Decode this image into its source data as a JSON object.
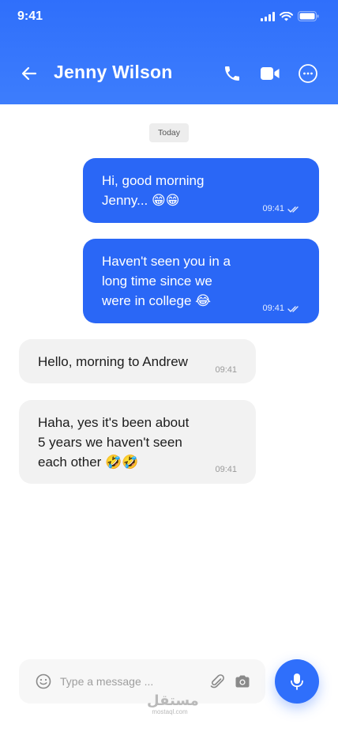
{
  "status_bar": {
    "time": "9:41"
  },
  "header": {
    "contact_name": "Jenny Wilson"
  },
  "date_divider": "Today",
  "messages": [
    {
      "direction": "outgoing",
      "text": "Hi, good morning\nJenny... 😁😁",
      "time": "09:41",
      "status": "read"
    },
    {
      "direction": "outgoing",
      "text": "Haven't seen you in a\nlong time since we\nwere in college 😂",
      "time": "09:41",
      "status": "read"
    },
    {
      "direction": "incoming",
      "text": "Hello, morning to Andrew",
      "time": "09:41"
    },
    {
      "direction": "incoming",
      "text": "Haha, yes it's been about\n5 years we haven't seen\neach other 🤣🤣",
      "time": "09:41"
    }
  ],
  "composer": {
    "placeholder": "Type a message ..."
  },
  "watermark": {
    "logo": "مستقل",
    "sub": "mostaql.com"
  },
  "colors": {
    "primary": "#2f6ffb",
    "outgoing_bubble": "#2a67f6",
    "incoming_bubble": "#f2f2f2"
  }
}
